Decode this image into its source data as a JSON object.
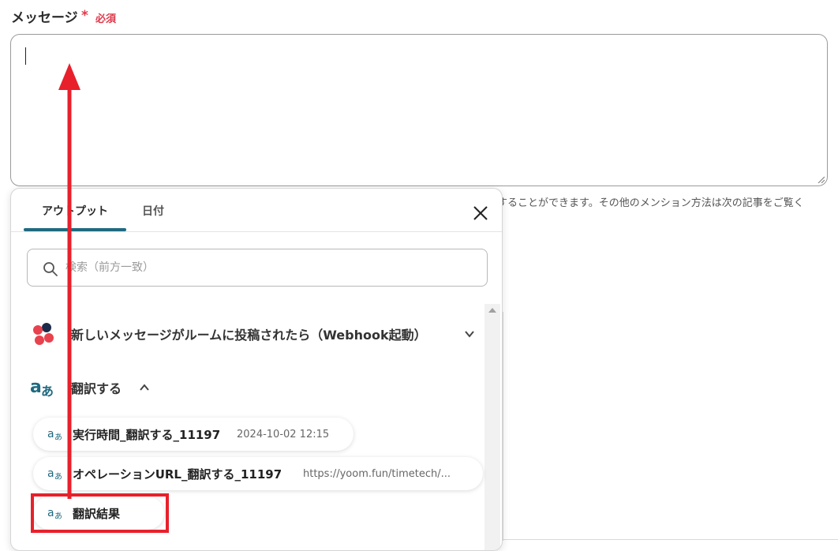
{
  "form": {
    "message_label": "メッセージ",
    "required_star": "*",
    "required_text": "必須",
    "help_text": "することができます。その他のメンション方法は次の記事をご覧く"
  },
  "panel": {
    "tabs": [
      {
        "label": "アウトプット",
        "active": true
      },
      {
        "label": "日付",
        "active": false
      }
    ],
    "search_placeholder": "検索（前方一致）",
    "sections": [
      {
        "label": "新しいメッセージがルームに投稿されたら（Webhook起動）",
        "icon": "chatwork-logo-icon",
        "expanded": false
      },
      {
        "label": "翻訳する",
        "icon": "translate-icon",
        "expanded": true
      }
    ],
    "items": [
      {
        "label": "実行時間_翻訳する_11197",
        "value": "2024-10-02 12:15"
      },
      {
        "label": "オペレーションURL_翻訳する_11197",
        "value": "https://yoom.fun/timetech/..."
      },
      {
        "label": "翻訳結果",
        "value": ""
      }
    ]
  },
  "colors": {
    "accent": "#1f6a80",
    "required": "#e0384b",
    "annotation": "#e8202b"
  }
}
